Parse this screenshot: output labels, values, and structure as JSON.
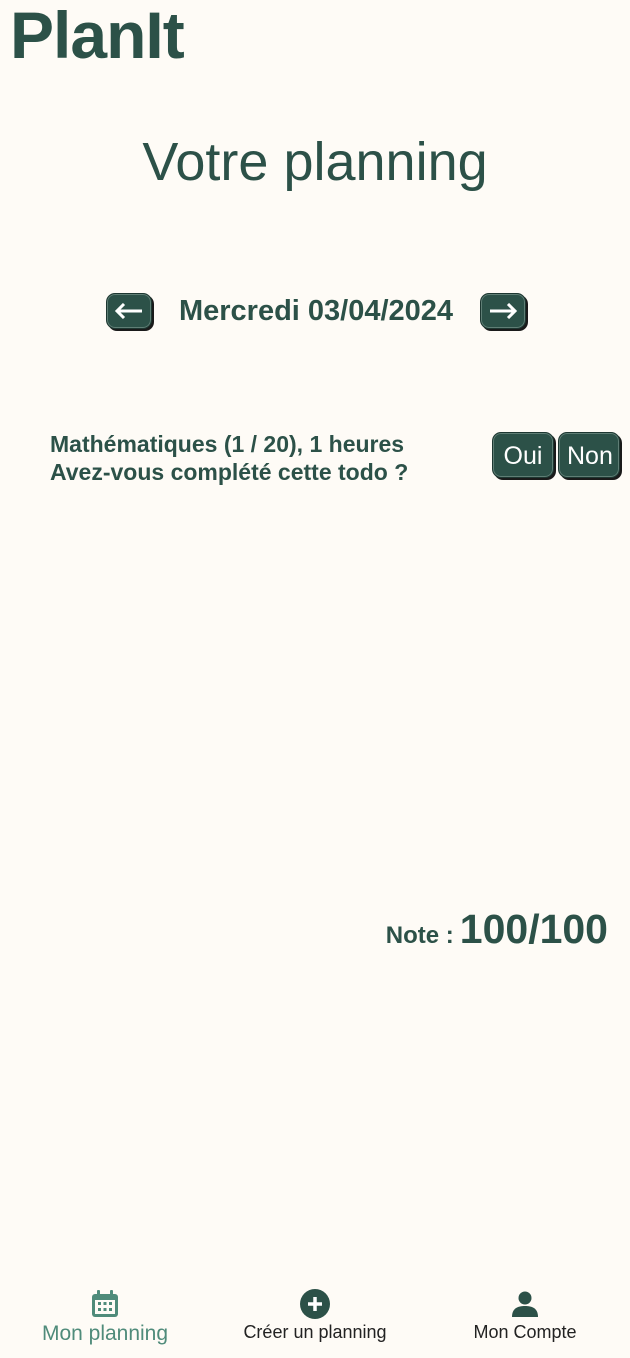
{
  "app": {
    "title": "PlanIt"
  },
  "page": {
    "title": "Votre planning"
  },
  "date_nav": {
    "date_label": "Mercredi 03/04/2024",
    "prev_icon": "arrow-left-icon",
    "next_icon": "arrow-right-icon"
  },
  "todo": {
    "line1": "Mathématiques (1 / 20), 1 heures",
    "line2": "Avez-vous complété cette todo ?",
    "yes_label": "Oui",
    "no_label": "Non"
  },
  "note": {
    "label": "Note :",
    "value": "100/100"
  },
  "bottom_nav": {
    "items": [
      {
        "label": "Mon planning",
        "icon": "calendar-icon",
        "active": true
      },
      {
        "label": "Créer un planning",
        "icon": "plus-circle-icon",
        "active": false
      },
      {
        "label": "Mon Compte",
        "icon": "person-icon",
        "active": false
      }
    ]
  },
  "colors": {
    "background": "#FEFBF6",
    "primary": "#2C5148",
    "active_nav": "#4F8B7A"
  }
}
